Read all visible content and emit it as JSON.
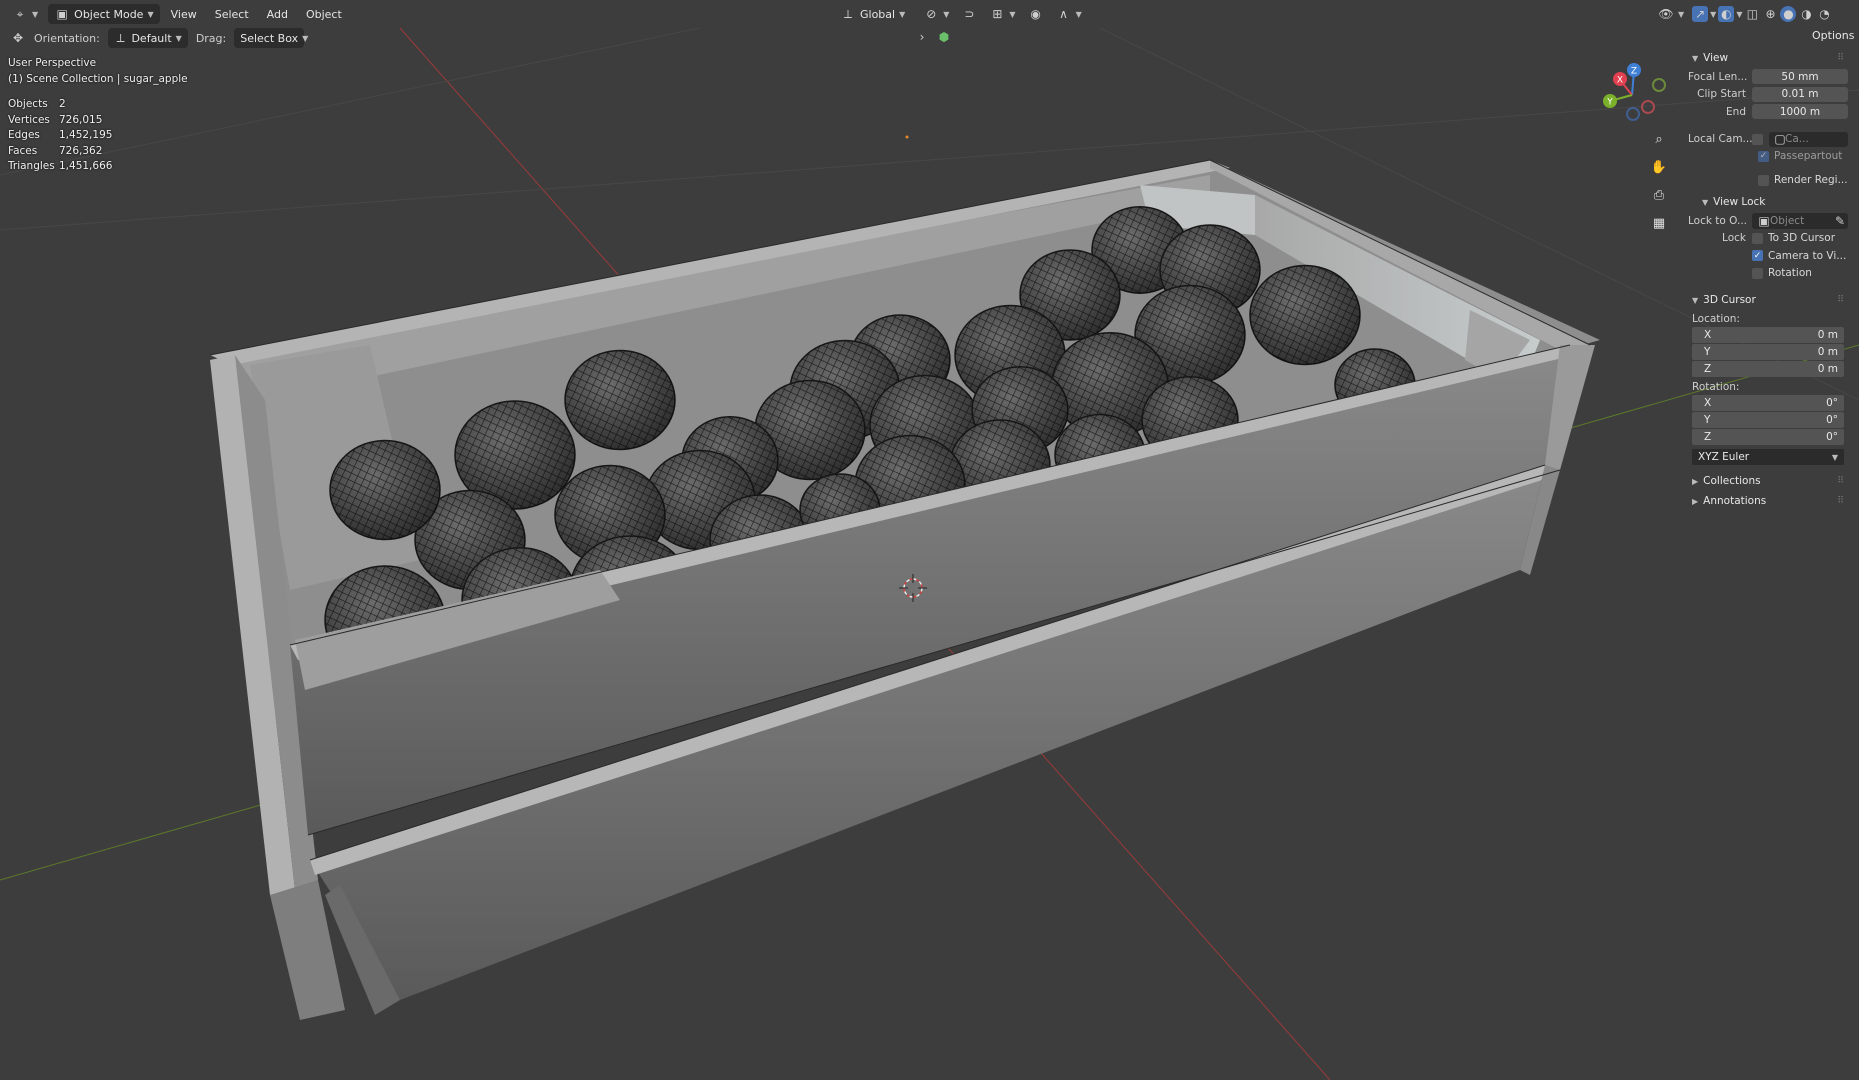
{
  "header": {
    "mode": "Object Mode",
    "menus": [
      "View",
      "Select",
      "Add",
      "Object"
    ],
    "transform_orientation": "Global",
    "options_label": "Options"
  },
  "toolheader": {
    "orientation_label": "Orientation:",
    "orientation_value": "Default",
    "drag_label": "Drag:",
    "drag_value": "Select Box"
  },
  "overlay": {
    "view_name": "User Perspective",
    "collection": "(1) Scene Collection | sugar_apple",
    "stats": [
      {
        "k": "Objects",
        "v": "2"
      },
      {
        "k": "Vertices",
        "v": "726,015"
      },
      {
        "k": "Edges",
        "v": "1,452,195"
      },
      {
        "k": "Faces",
        "v": "726,362"
      },
      {
        "k": "Triangles",
        "v": "1,451,666"
      }
    ]
  },
  "gizmo": {
    "x": "X",
    "y": "Y",
    "z": "Z"
  },
  "sidebar": {
    "view_panel": "View",
    "focal_label": "Focal Len...",
    "focal_value": "50 mm",
    "clip_start_label": "Clip Start",
    "clip_start_value": "0.01 m",
    "end_label": "End",
    "end_value": "1000 m",
    "local_cam_label": "Local Cam...",
    "local_cam_value": "Ca...",
    "passepartout": "Passepartout",
    "render_region": "Render Regi...",
    "view_lock_panel": "View Lock",
    "lock_to_label": "Lock to O...",
    "lock_to_placeholder": "Object",
    "lock_label": "Lock",
    "to_3d_cursor": "To 3D Cursor",
    "camera_to_view": "Camera to Vi...",
    "rotation_lock": "Rotation",
    "cursor_panel": "3D Cursor",
    "location_label": "Location:",
    "loc": [
      {
        "axis": "X",
        "val": "0 m"
      },
      {
        "axis": "Y",
        "val": "0 m"
      },
      {
        "axis": "Z",
        "val": "0 m"
      }
    ],
    "rotation_label": "Rotation:",
    "rot": [
      {
        "axis": "X",
        "val": "0°"
      },
      {
        "axis": "Y",
        "val": "0°"
      },
      {
        "axis": "Z",
        "val": "0°"
      }
    ],
    "rot_mode": "XYZ Euler",
    "collections_panel": "Collections",
    "annotations_panel": "Annotations"
  },
  "colors": {
    "viewport_bg": "#3d3d3d",
    "accent_blue": "#4772b3",
    "axis_x": "#e0404f",
    "axis_y": "#7bb02b",
    "axis_z": "#3f7fd6"
  }
}
